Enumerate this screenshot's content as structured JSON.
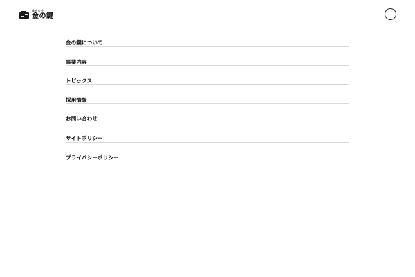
{
  "header": {
    "logo": {
      "subtitle": "株式会社",
      "name": "金の鍵",
      "mark_icon": "key-card-logo-icon",
      "mark_color": "#1a1a1a",
      "mark_accent": "#e6e6e6"
    },
    "menu_button_icon": "circle-menu-icon"
  },
  "nav": {
    "items": [
      {
        "label": "金の鍵について"
      },
      {
        "label": "事業内容"
      },
      {
        "label": "トピックス"
      },
      {
        "label": "採用情報"
      },
      {
        "label": "お問い合わせ"
      },
      {
        "label": "サイトポリシー"
      },
      {
        "label": "プライバシーポリシー"
      }
    ],
    "divider_color": "#d9d9d9"
  }
}
